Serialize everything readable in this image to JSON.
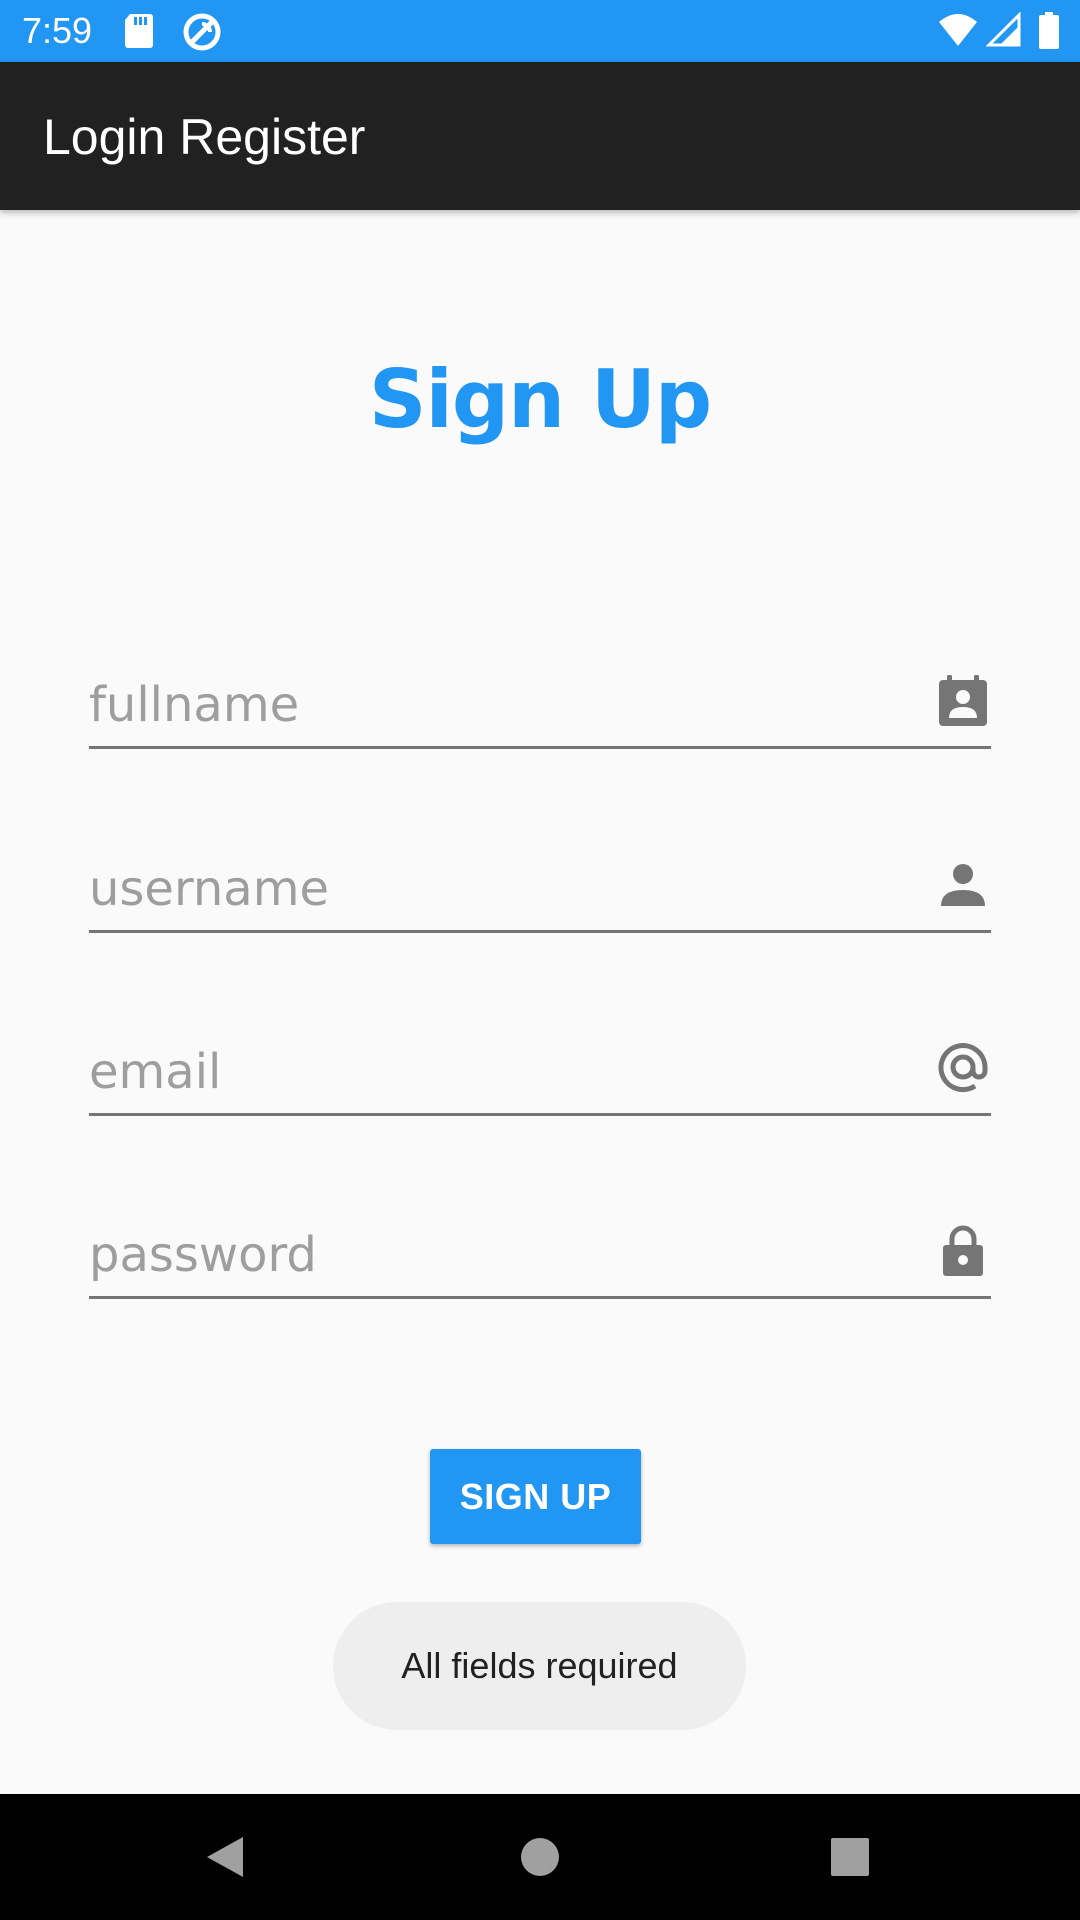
{
  "status_bar": {
    "time": "7:59",
    "left_icons": [
      "sd-card-icon",
      "sync-icon"
    ],
    "right_icons": [
      "wifi-icon",
      "signal-icon",
      "battery-icon"
    ],
    "background_color": "#2196f3"
  },
  "app_bar": {
    "title": "Login Register",
    "background_color": "#212121"
  },
  "form": {
    "heading": "Sign Up",
    "accent_color": "#2196f3",
    "fields": [
      {
        "placeholder": "fullname",
        "value": "",
        "icon": "contact-card-icon"
      },
      {
        "placeholder": "username",
        "value": "",
        "icon": "person-icon"
      },
      {
        "placeholder": "email",
        "value": "",
        "icon": "at-sign-icon"
      },
      {
        "placeholder": "password",
        "value": "",
        "icon": "lock-icon"
      }
    ],
    "submit_label": "SIGN UP"
  },
  "toast": {
    "message": "All fields required"
  },
  "nav_bar": {
    "buttons": [
      "back-icon",
      "home-icon",
      "recents-icon"
    ]
  }
}
